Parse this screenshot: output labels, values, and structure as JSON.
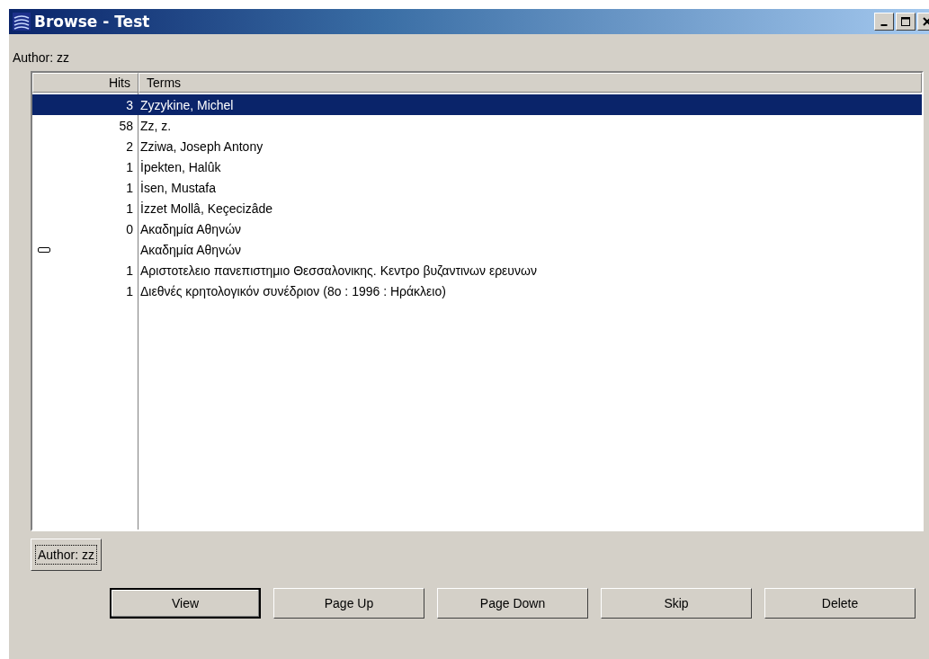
{
  "window": {
    "title": "Browse - Test"
  },
  "query_label": "Author: zz",
  "table": {
    "columns": [
      "Hits",
      "Terms"
    ],
    "rows": [
      {
        "kind": "entry",
        "hits": "3",
        "term": "Zyzykine, Michel",
        "selected": true
      },
      {
        "kind": "entry",
        "hits": "58",
        "term": "Zz, z.",
        "selected": false
      },
      {
        "kind": "entry",
        "hits": "2",
        "term": "Zziwa, Joseph Antony",
        "selected": false
      },
      {
        "kind": "entry",
        "hits": "1",
        "term": "İpekten, Halûk",
        "selected": false
      },
      {
        "kind": "entry",
        "hits": "1",
        "term": "İsen, Mustafa",
        "selected": false
      },
      {
        "kind": "entry",
        "hits": "1",
        "term": "İzzet Mollâ, Keçecizâde",
        "selected": false
      },
      {
        "kind": "entry",
        "hits": "0",
        "term": "Ακαδημία Αθηνών",
        "selected": false
      },
      {
        "kind": "reference",
        "term": "Ακαδημία Αθηνών",
        "selected": false
      },
      {
        "kind": "entry",
        "hits": "1",
        "term": "Αριστοτελειο πανεπιστημιο Θεσσαλονικης. Κεντρο βυζαντινων ερευνων",
        "selected": false
      },
      {
        "kind": "entry",
        "hits": "1",
        "term": "Διεθνές κρητολογικόν συνέδριον (8ο : 1996 : Ηράκλειο)",
        "selected": false
      }
    ]
  },
  "tabs": [
    {
      "label": "Author: zz",
      "selected": true
    }
  ],
  "buttons": [
    {
      "label": "View",
      "default": true
    },
    {
      "label": "Page Up",
      "default": false
    },
    {
      "label": "Page Down",
      "default": false
    },
    {
      "label": "Skip",
      "default": false
    },
    {
      "label": "Delete",
      "default": false
    }
  ]
}
